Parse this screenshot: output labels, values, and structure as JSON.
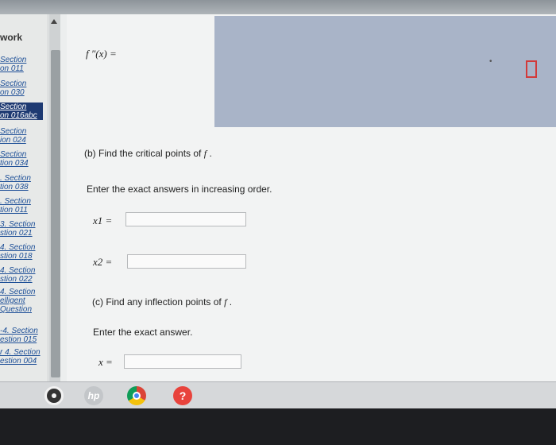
{
  "sidebar": {
    "title": "work",
    "items": [
      {
        "line1": "Section",
        "line2": "on 011"
      },
      {
        "line1": "Section",
        "line2": "on 030"
      },
      {
        "line1": "Section",
        "line2": "on 016abc"
      },
      {
        "line1": "Section",
        "line2": "ion 024"
      },
      {
        "line1": "Section",
        "line2": "tion 034"
      },
      {
        "line1": ". Section",
        "line2": "tion 038"
      },
      {
        "line1": ". Section",
        "line2": "tion 011"
      },
      {
        "line1": "3. Section",
        "line2": "stion 021"
      },
      {
        "line1": "4. Section",
        "line2": "stion 018"
      },
      {
        "line1": "4. Section",
        "line2": "stion 022"
      },
      {
        "line1": "4. Section",
        "line2": "elligent"
      },
      {
        "line1": "Question",
        "line2": ""
      },
      {
        "line1": "-4. Section",
        "line2": "estion 015"
      },
      {
        "line1": "r 4. Section",
        "line2": "estion 004"
      }
    ]
  },
  "problem": {
    "f_double_prime_label": "f ″(x) =",
    "part_b": {
      "prompt": "(b) Find the critical points of",
      "func": "f",
      "end": ".",
      "instruction": "Enter the exact answers in increasing order.",
      "x1_label": "x1 =",
      "x2_label": "x2 =",
      "x1_value": "",
      "x2_value": ""
    },
    "part_c": {
      "prompt": "(c) Find any inflection points of",
      "func": "f",
      "end": ".",
      "instruction": "Enter the exact answer.",
      "x_label": "x =",
      "x_value": ""
    }
  },
  "taskbar": {
    "icons": [
      "app-launcher-icon",
      "hp-icon",
      "chrome-icon",
      "help-icon"
    ],
    "hp_text": "hp",
    "help_text": "?"
  }
}
